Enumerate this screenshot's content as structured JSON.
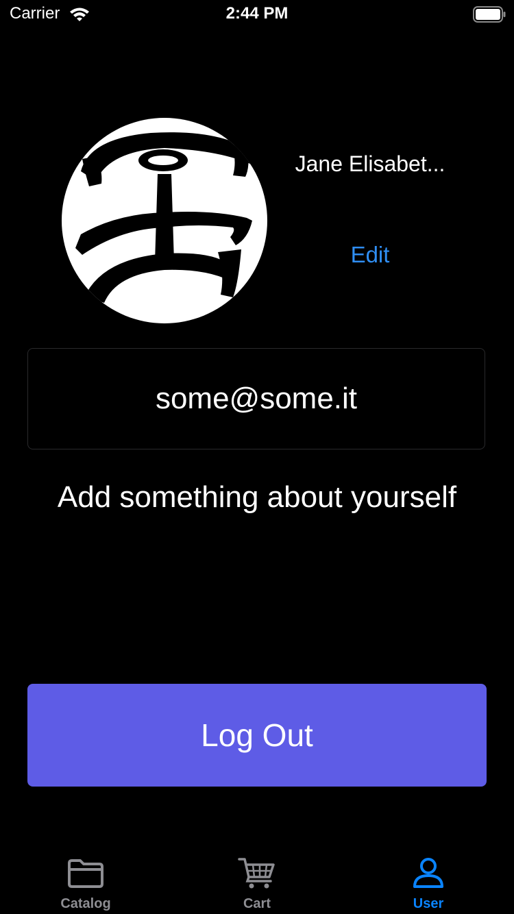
{
  "status_bar": {
    "carrier": "Carrier",
    "time": "2:44 PM"
  },
  "profile": {
    "name": "Jane Elisabet...",
    "edit_label": "Edit",
    "email": "some@some.it",
    "about": "Add something about yourself"
  },
  "actions": {
    "logout_label": "Log Out",
    "logout_color": "#5e5ce6"
  },
  "tab_bar": {
    "tabs": [
      {
        "label": "Catalog",
        "icon": "folder-icon",
        "active": false
      },
      {
        "label": "Cart",
        "icon": "cart-icon",
        "active": false
      },
      {
        "label": "User",
        "icon": "person-icon",
        "active": true
      }
    ],
    "active_color": "#0a84ff",
    "inactive_color": "#8e8e93"
  },
  "colors": {
    "background": "#000000",
    "link": "#2f8ef3"
  }
}
